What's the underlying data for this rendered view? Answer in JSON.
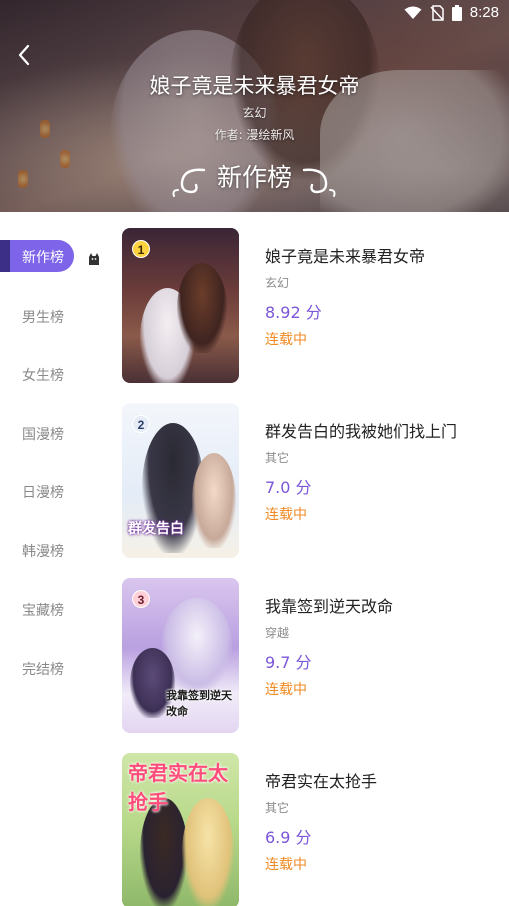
{
  "status_bar": {
    "time": "8:28"
  },
  "header": {
    "title": "娘子竟是未来暴君女帝",
    "genre": "玄幻",
    "author": "作者: 漫绘新风",
    "rank_name": "新作榜"
  },
  "sidebar": {
    "items": [
      {
        "label": "新作榜",
        "active": true
      },
      {
        "label": "男生榜"
      },
      {
        "label": "女生榜"
      },
      {
        "label": "国漫榜"
      },
      {
        "label": "日漫榜"
      },
      {
        "label": "韩漫榜"
      },
      {
        "label": "宝藏榜"
      },
      {
        "label": "完结榜"
      }
    ]
  },
  "books": [
    {
      "rank": "1",
      "title": "娘子竟是未来暴君女帝",
      "genre": "玄幻",
      "score": "8.92 分",
      "status": "连载中"
    },
    {
      "rank": "2",
      "title": "群发告白的我被她们找上门",
      "genre": "其它",
      "score": "7.0 分",
      "status": "连载中",
      "cover_text": "群发告白"
    },
    {
      "rank": "3",
      "title": "我靠签到逆天改命",
      "genre": "穿越",
      "score": "9.7 分",
      "status": "连载中",
      "cover_text": "我靠签到逆天改命"
    },
    {
      "title": "帝君实在太抢手",
      "genre": "其它",
      "score": "6.9 分",
      "status": "连载中",
      "cover_text": "帝君实在太抢手"
    }
  ],
  "colors": {
    "accent": "#7d64e8",
    "score": "#7b56d9",
    "status": "#f08a24"
  }
}
